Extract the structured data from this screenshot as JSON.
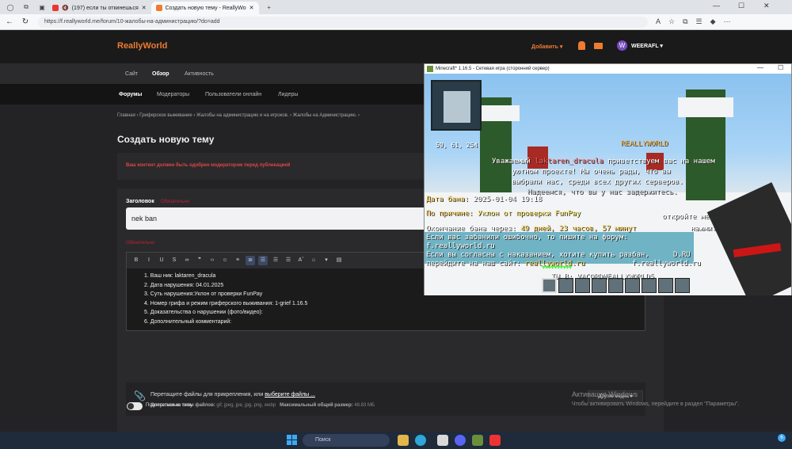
{
  "browser": {
    "tabs": [
      {
        "label": "(197) если ты откинешься",
        "icon": "youtube-icon"
      },
      {
        "label": "Создать новую тему - ReallyWo",
        "icon": "reallyworld-icon"
      }
    ],
    "url": "https://f.reallyworld.me/forum/10-жалобы-на-администрацию/?do=add"
  },
  "site": {
    "logo": "ReallyWorld",
    "add_label": "Добавить ▾",
    "username": "WEERAFL ▾",
    "avatar_letter": "W",
    "nav1": [
      "Сайт",
      "Обзор",
      "Активность"
    ],
    "nav2": [
      "Форумы",
      "Модераторы",
      "Пользователи онлайн",
      "Лидеры"
    ],
    "breadcrumb": "Главная  ›  Гриферское выживание  ›  Жалобы на администрацию и на игроков.  ›  Жалобы на Администрацию.  ›",
    "page_title": "Создать новую тему",
    "notice": "Ваш контент должен быть одобрен модератором перед публикацией",
    "form": {
      "title_label": "Заголовок",
      "required": "Обязательно",
      "title_value": "nek ban",
      "body_required": "Обязательно",
      "editor_lines": [
        "1. Ваш ник: laktaren_dracula",
        "2. Дата нарушения: 04.01.2025",
        "3. Суть нарушения:Уклон от проверки FunPay",
        "4. Номер грифа и режим гриферского выживания: 1-grief 1.16.5",
        "5. Доказательства о нарушении (фото/видео):",
        "6. Дополнительный комментарий:"
      ],
      "upload_text": "Перетащите файлы для прикрепления, или ",
      "upload_link": "выберите файлы ...",
      "types_label": "Допустимые типы файлов:",
      "types_value": " gif, jpeg, jpe, jpg, png, webp",
      "maxsize_label": "Максимальный общий размер:",
      "maxsize_value": " 48.83 МБ",
      "media_button": "Другие медиа ▾",
      "subscribe": "Подписаться на тему"
    }
  },
  "minecraft": {
    "title": "Minecraft* 1.16.5 - Сетевая игра (сторонний сервер)",
    "coords": "59, 61, 254",
    "sign": "REALLYWORLD",
    "chat": {
      "welcome_1a": "Уважаемый ",
      "welcome_1b": "laktaren_dracula",
      "welcome_1c": " приветствуем вас на нашем",
      "welcome_2": "уютном проекте! Мы очень рады, что вы",
      "welcome_3": "выбрали нас, среди всех других серверов.",
      "welcome_4": "Надеемся, что вы у нас задержитесь.",
      "ban_date_label": "Дата бана: ",
      "ban_date": "2025-01-04 19:18",
      "reason_label": "По причине: ",
      "reason": "Уклон от проверки FunPay",
      "end_label": "Окончание бана через: ",
      "end": "49 дней, 23 часов, 57 минут",
      "compass": "откройте меню компаса",
      "mistake_1": "Если вас забанили ошибочно, то пишите на форум:",
      "mistake_2": " f.reallyworld.ru",
      "unban_1": "Если вы согласны с наказанием, хотите купить разбан,",
      "unban_2a": " перейдите на наш сайт: ",
      "unban_2b": "reallyworld.ru",
      "right_1": "нажмите на",
      "right_2": "D.RU",
      "right_3": "f.reallyworld.ru"
    },
    "name_tag": "ТЫ В: VACORDMEALLYWORLD5"
  },
  "windows": {
    "activation_title": "Активация Windows",
    "activation_sub": "Чтобы активировать Windows, перейдите в раздел \"Параметры\".",
    "search": "Поиск",
    "notif_count": "6"
  }
}
